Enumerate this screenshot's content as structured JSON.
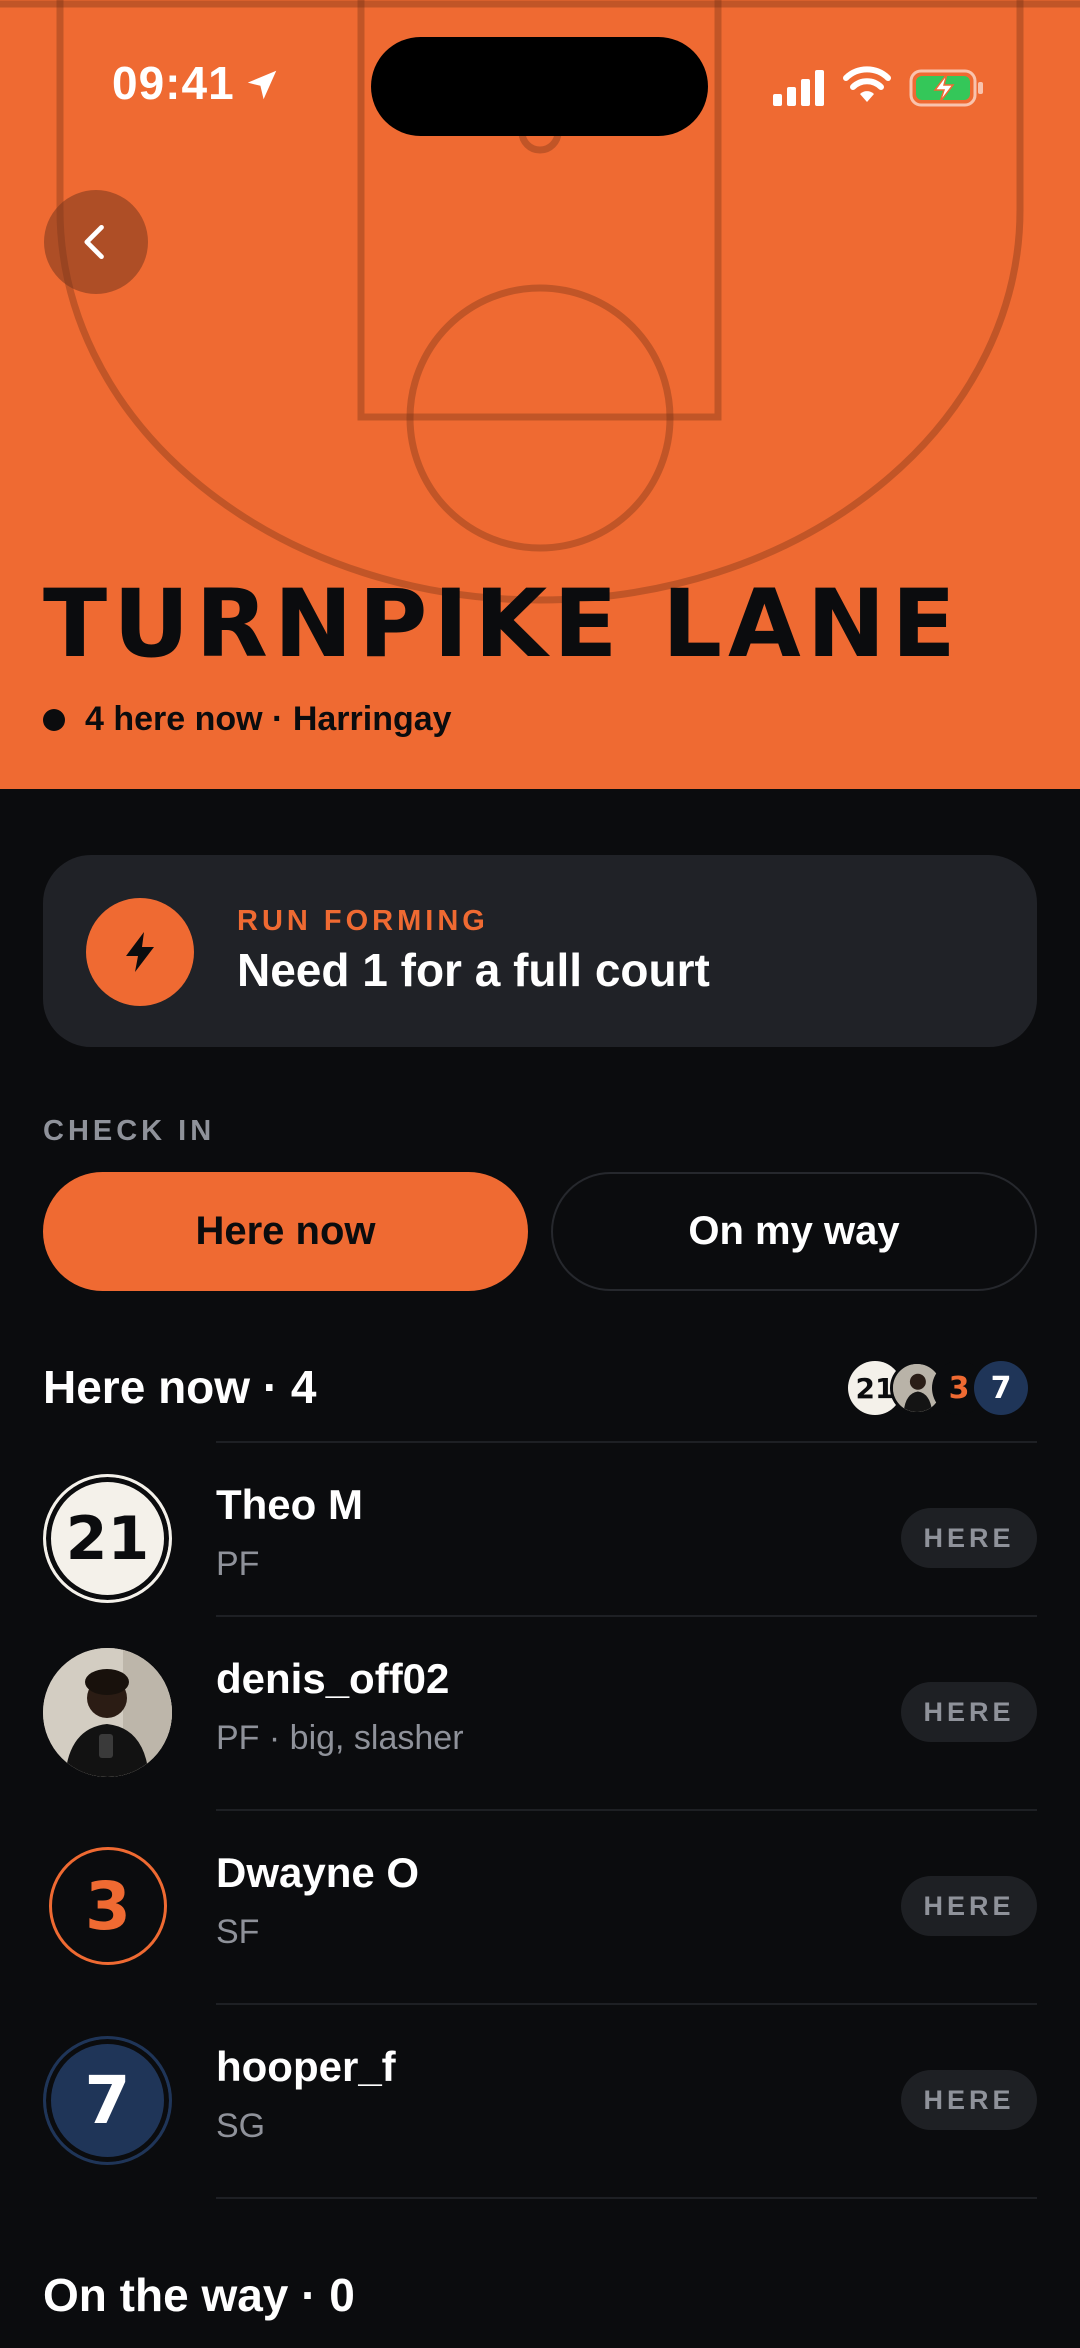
{
  "status_bar": {
    "time": "09:41"
  },
  "hero": {
    "title": "TURNPIKE LANE",
    "presence": "4 here now · Harringay"
  },
  "run_card": {
    "eyebrow": "RUN FORMING",
    "title": "Need 1 for a full court"
  },
  "check_in": {
    "label": "CHECK IN",
    "here_now": "Here now",
    "on_my_way": "On my way"
  },
  "here_now_section": {
    "title": "Here now · 4",
    "stack": [
      "21",
      "3",
      "7"
    ],
    "players": [
      {
        "avatar": "21",
        "name": "Theo M",
        "meta": "PF",
        "status": "HERE"
      },
      {
        "avatar": "",
        "name": "denis_off02",
        "meta": "PF · big, slasher",
        "status": "HERE"
      },
      {
        "avatar": "3",
        "name": "Dwayne O",
        "meta": "SF",
        "status": "HERE"
      },
      {
        "avatar": "7",
        "name": "hooper_f",
        "meta": "SG",
        "status": "HERE"
      }
    ]
  },
  "on_the_way_section": {
    "title": "On the way · 0"
  },
  "colors": {
    "accent": "#ef6a32",
    "background": "#0b0c0e",
    "card": "#202227",
    "navy": "#1f3558",
    "muted": "#8f929a"
  }
}
